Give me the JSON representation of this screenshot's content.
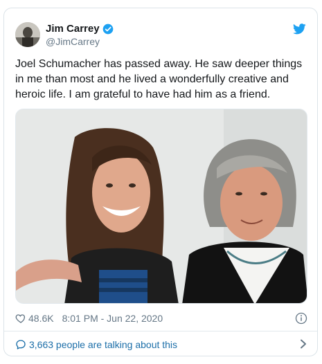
{
  "tweet": {
    "author_name": "Jim Carrey",
    "author_handle": "@JimCarrey",
    "text": "Joel Schumacher has passed away. He saw deeper things in me than most and he lived a wonderfully creative and heroic life. I am grateful to have had him as a friend.",
    "likes": "48.6K",
    "timestamp": "8:01 PM - Jun 22, 2020",
    "talking_text": "3,663 people are talking about this"
  },
  "colors": {
    "brand_blue": "#1da1f2",
    "link_blue": "#1b6ea8",
    "text": "#14171a",
    "muted": "#657786"
  },
  "icons": {
    "verified": "verified-badge-icon",
    "brand": "twitter-bird-icon",
    "like": "heart-icon",
    "info": "info-icon",
    "reply": "speech-bubble-icon",
    "more": "chevron-right-icon"
  }
}
